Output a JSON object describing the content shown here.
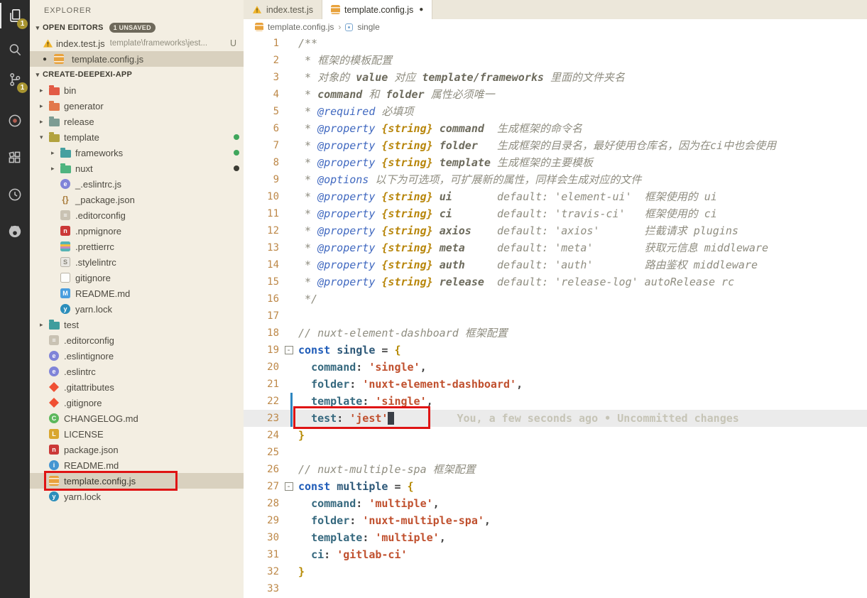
{
  "palette": {
    "annotation_red": "#df1414",
    "sidebar_bg": "#f3eee2",
    "activity_bar_bg": "#2b2b2b",
    "badge_yellow": "#a89430",
    "selection_bg": "#d9d1bf"
  },
  "activity_bar": {
    "explorer_badge": "1",
    "scm_badge": "1"
  },
  "sidebar": {
    "title": "EXPLORER",
    "open_editors": {
      "label": "OPEN EDITORS",
      "badge": "1 UNSAVED",
      "items": [
        {
          "name": "index.test.js",
          "path": "template\\frameworks\\jest...",
          "status": "U"
        },
        {
          "name": "template.config.js",
          "dirty": "●"
        }
      ]
    },
    "project": {
      "label": "CREATE-DEEPEXI-APP",
      "tree": [
        {
          "label": "bin",
          "kind": "folder",
          "icon": "folder-bin",
          "color": "#e25b45",
          "indent": 0
        },
        {
          "label": "generator",
          "kind": "folder",
          "icon": "folder-generator",
          "color": "#e2784a",
          "indent": 0
        },
        {
          "label": "release",
          "kind": "folder",
          "icon": "folder-release",
          "color": "#7d9c93",
          "indent": 0
        },
        {
          "label": "template",
          "kind": "folder",
          "icon": "folder-template",
          "color": "#b2a23e",
          "indent": 0,
          "expanded": true,
          "dot": "#3fa65c"
        },
        {
          "label": "frameworks",
          "kind": "folder",
          "icon": "folder-frameworks",
          "color": "#46a0a0",
          "indent": 1,
          "dot": "#3fa65c"
        },
        {
          "label": "nuxt",
          "kind": "folder",
          "icon": "folder-nuxt",
          "color": "#4fb47f",
          "indent": 1,
          "dot": "#3c3c34"
        },
        {
          "label": "_.eslintrc.js",
          "kind": "file",
          "icon": "eslint",
          "indent": 1
        },
        {
          "label": "_package.json",
          "kind": "file",
          "icon": "json-braces",
          "indent": 1
        },
        {
          "label": ".editorconfig",
          "kind": "file",
          "icon": "editorconfig",
          "indent": 1
        },
        {
          "label": ".npmignore",
          "kind": "file",
          "icon": "npm",
          "indent": 1
        },
        {
          "label": ".prettierrc",
          "kind": "file",
          "icon": "prettier",
          "indent": 1
        },
        {
          "label": ".stylelintrc",
          "kind": "file",
          "icon": "stylelint",
          "indent": 1
        },
        {
          "label": "gitignore",
          "kind": "file",
          "icon": "file-generic",
          "indent": 1
        },
        {
          "label": "README.md",
          "kind": "file",
          "icon": "markdown",
          "indent": 1
        },
        {
          "label": "yarn.lock",
          "kind": "file",
          "icon": "yarn",
          "indent": 1
        },
        {
          "label": "test",
          "kind": "folder",
          "icon": "folder-test",
          "color": "#3f9d9d",
          "indent": 0
        },
        {
          "label": ".editorconfig",
          "kind": "file",
          "icon": "editorconfig",
          "indent": 0
        },
        {
          "label": ".eslintignore",
          "kind": "file",
          "icon": "eslint",
          "indent": 0
        },
        {
          "label": ".eslintrc",
          "kind": "file",
          "icon": "eslint",
          "indent": 0
        },
        {
          "label": ".gitattributes",
          "kind": "file",
          "icon": "git",
          "indent": 0
        },
        {
          "label": ".gitignore",
          "kind": "file",
          "icon": "git",
          "indent": 0
        },
        {
          "label": "CHANGELOG.md",
          "kind": "file",
          "icon": "changelog",
          "indent": 0
        },
        {
          "label": "LICENSE",
          "kind": "file",
          "icon": "license",
          "indent": 0
        },
        {
          "label": "package.json",
          "kind": "file",
          "icon": "npm",
          "indent": 0
        },
        {
          "label": "README.md",
          "kind": "file",
          "icon": "readme",
          "indent": 0
        },
        {
          "label": "template.config.js",
          "kind": "file",
          "icon": "config",
          "indent": 0,
          "selected": true,
          "annotated": true
        },
        {
          "label": "yarn.lock",
          "kind": "file",
          "icon": "yarn",
          "indent": 0
        }
      ]
    }
  },
  "tabs": [
    {
      "label": "index.test.js"
    },
    {
      "label": "template.config.js",
      "dirty": "●"
    }
  ],
  "breadcrumbs": {
    "file": "template.config.js",
    "separator": "›",
    "symbol": "single"
  },
  "editor": {
    "lines": [
      {
        "n": 1,
        "tokens": [
          [
            "c",
            "/**"
          ]
        ]
      },
      {
        "n": 2,
        "tokens": [
          [
            "c",
            " * 框架的模板配置"
          ]
        ]
      },
      {
        "n": 3,
        "tokens": [
          [
            "c",
            " * 对象的 "
          ],
          [
            "ce",
            "value"
          ],
          [
            "c",
            " 对应 "
          ],
          [
            "ce",
            "template/frameworks"
          ],
          [
            "c",
            " 里面的文件夹名"
          ]
        ]
      },
      {
        "n": 4,
        "tokens": [
          [
            "c",
            " * "
          ],
          [
            "ce",
            "command"
          ],
          [
            "c",
            " 和 "
          ],
          [
            "ce",
            "folder"
          ],
          [
            "c",
            " 属性必须唯一"
          ]
        ]
      },
      {
        "n": 5,
        "tokens": [
          [
            "c",
            " * "
          ],
          [
            "tag",
            "@required"
          ],
          [
            "c",
            " 必填项"
          ]
        ]
      },
      {
        "n": 6,
        "tokens": [
          [
            "c",
            " * "
          ],
          [
            "tag",
            "@property"
          ],
          [
            "c",
            " "
          ],
          [
            "typ",
            "{string}"
          ],
          [
            "c",
            " "
          ],
          [
            "ce",
            "command"
          ],
          [
            "c",
            "  生成框架的命令名"
          ]
        ]
      },
      {
        "n": 7,
        "tokens": [
          [
            "c",
            " * "
          ],
          [
            "tag",
            "@property"
          ],
          [
            "c",
            " "
          ],
          [
            "typ",
            "{string}"
          ],
          [
            "c",
            " "
          ],
          [
            "ce",
            "folder"
          ],
          [
            "c",
            "   生成框架的目录名，最好使用仓库名，因为在ci中也会使用"
          ]
        ]
      },
      {
        "n": 8,
        "tokens": [
          [
            "c",
            " * "
          ],
          [
            "tag",
            "@property"
          ],
          [
            "c",
            " "
          ],
          [
            "typ",
            "{string}"
          ],
          [
            "c",
            " "
          ],
          [
            "ce",
            "template"
          ],
          [
            "c",
            " 生成框架的主要模板"
          ]
        ]
      },
      {
        "n": 9,
        "tokens": [
          [
            "c",
            " * "
          ],
          [
            "tag",
            "@options"
          ],
          [
            "c",
            " 以下为可选项，可扩展新的属性，同样会生成对应的文件"
          ]
        ]
      },
      {
        "n": 10,
        "tokens": [
          [
            "c",
            " * "
          ],
          [
            "tag",
            "@property"
          ],
          [
            "c",
            " "
          ],
          [
            "typ",
            "{string}"
          ],
          [
            "c",
            " "
          ],
          [
            "ce",
            "ui"
          ],
          [
            "c",
            "       default: 'element-ui'  框架使用的 ui"
          ]
        ]
      },
      {
        "n": 11,
        "tokens": [
          [
            "c",
            " * "
          ],
          [
            "tag",
            "@property"
          ],
          [
            "c",
            " "
          ],
          [
            "typ",
            "{string}"
          ],
          [
            "c",
            " "
          ],
          [
            "ce",
            "ci"
          ],
          [
            "c",
            "       default: 'travis-ci'   框架使用的 ci"
          ]
        ]
      },
      {
        "n": 12,
        "tokens": [
          [
            "c",
            " * "
          ],
          [
            "tag",
            "@property"
          ],
          [
            "c",
            " "
          ],
          [
            "typ",
            "{string}"
          ],
          [
            "c",
            " "
          ],
          [
            "ce",
            "axios"
          ],
          [
            "c",
            "    default: 'axios'       拦截请求 plugins"
          ]
        ]
      },
      {
        "n": 13,
        "tokens": [
          [
            "c",
            " * "
          ],
          [
            "tag",
            "@property"
          ],
          [
            "c",
            " "
          ],
          [
            "typ",
            "{string}"
          ],
          [
            "c",
            " "
          ],
          [
            "ce",
            "meta"
          ],
          [
            "c",
            "     default: 'meta'        获取元信息 middleware"
          ]
        ]
      },
      {
        "n": 14,
        "tokens": [
          [
            "c",
            " * "
          ],
          [
            "tag",
            "@property"
          ],
          [
            "c",
            " "
          ],
          [
            "typ",
            "{string}"
          ],
          [
            "c",
            " "
          ],
          [
            "ce",
            "auth"
          ],
          [
            "c",
            "     default: 'auth'        路由鉴权 middleware"
          ]
        ]
      },
      {
        "n": 15,
        "tokens": [
          [
            "c",
            " * "
          ],
          [
            "tag",
            "@property"
          ],
          [
            "c",
            " "
          ],
          [
            "typ",
            "{string}"
          ],
          [
            "c",
            " "
          ],
          [
            "ce",
            "release"
          ],
          [
            "c",
            "  default: 'release-log' autoRelease rc"
          ]
        ]
      },
      {
        "n": 16,
        "tokens": [
          [
            "c",
            " */"
          ]
        ]
      },
      {
        "n": 17,
        "tokens": []
      },
      {
        "n": 18,
        "tokens": [
          [
            "c",
            "// nuxt-element-dashboard 框架配置"
          ]
        ]
      },
      {
        "n": 19,
        "fold": true,
        "tokens": [
          [
            "kw",
            "const"
          ],
          [
            "txt",
            " "
          ],
          [
            "id",
            "single"
          ],
          [
            "txt",
            " = "
          ],
          [
            "br",
            "{"
          ]
        ]
      },
      {
        "n": 20,
        "tokens": [
          [
            "txt",
            "  "
          ],
          [
            "prop",
            "command"
          ],
          [
            "txt",
            ": "
          ],
          [
            "str",
            "'single'"
          ],
          [
            "txt",
            ","
          ]
        ]
      },
      {
        "n": 21,
        "tokens": [
          [
            "txt",
            "  "
          ],
          [
            "prop",
            "folder"
          ],
          [
            "txt",
            ": "
          ],
          [
            "str",
            "'nuxt-element-dashboard'"
          ],
          [
            "txt",
            ","
          ]
        ]
      },
      {
        "n": 22,
        "modified": true,
        "tokens": [
          [
            "txt",
            "  "
          ],
          [
            "prop",
            "template"
          ],
          [
            "txt",
            ": "
          ],
          [
            "str",
            "'single'"
          ],
          [
            "txt",
            ","
          ]
        ]
      },
      {
        "n": 23,
        "modified": true,
        "current": true,
        "cursor": true,
        "annotation": "You, a few seconds ago • Uncommitted changes",
        "tokens": [
          [
            "txt",
            "  "
          ],
          [
            "prop",
            "test"
          ],
          [
            "txt",
            ": "
          ],
          [
            "str",
            "'jest'"
          ]
        ]
      },
      {
        "n": 24,
        "tokens": [
          [
            "br",
            "}"
          ]
        ]
      },
      {
        "n": 25,
        "tokens": []
      },
      {
        "n": 26,
        "tokens": [
          [
            "c",
            "// nuxt-multiple-spa 框架配置"
          ]
        ]
      },
      {
        "n": 27,
        "fold": true,
        "tokens": [
          [
            "kw",
            "const"
          ],
          [
            "txt",
            " "
          ],
          [
            "id",
            "multiple"
          ],
          [
            "txt",
            " = "
          ],
          [
            "br",
            "{"
          ]
        ]
      },
      {
        "n": 28,
        "tokens": [
          [
            "txt",
            "  "
          ],
          [
            "prop",
            "command"
          ],
          [
            "txt",
            ": "
          ],
          [
            "str",
            "'multiple'"
          ],
          [
            "txt",
            ","
          ]
        ]
      },
      {
        "n": 29,
        "tokens": [
          [
            "txt",
            "  "
          ],
          [
            "prop",
            "folder"
          ],
          [
            "txt",
            ": "
          ],
          [
            "str",
            "'nuxt-multiple-spa'"
          ],
          [
            "txt",
            ","
          ]
        ]
      },
      {
        "n": 30,
        "tokens": [
          [
            "txt",
            "  "
          ],
          [
            "prop",
            "template"
          ],
          [
            "txt",
            ": "
          ],
          [
            "str",
            "'multiple'"
          ],
          [
            "txt",
            ","
          ]
        ]
      },
      {
        "n": 31,
        "tokens": [
          [
            "txt",
            "  "
          ],
          [
            "prop",
            "ci"
          ],
          [
            "txt",
            ": "
          ],
          [
            "str",
            "'gitlab-ci'"
          ]
        ]
      },
      {
        "n": 32,
        "tokens": [
          [
            "br",
            "}"
          ]
        ]
      },
      {
        "n": 33,
        "tokens": []
      }
    ]
  }
}
